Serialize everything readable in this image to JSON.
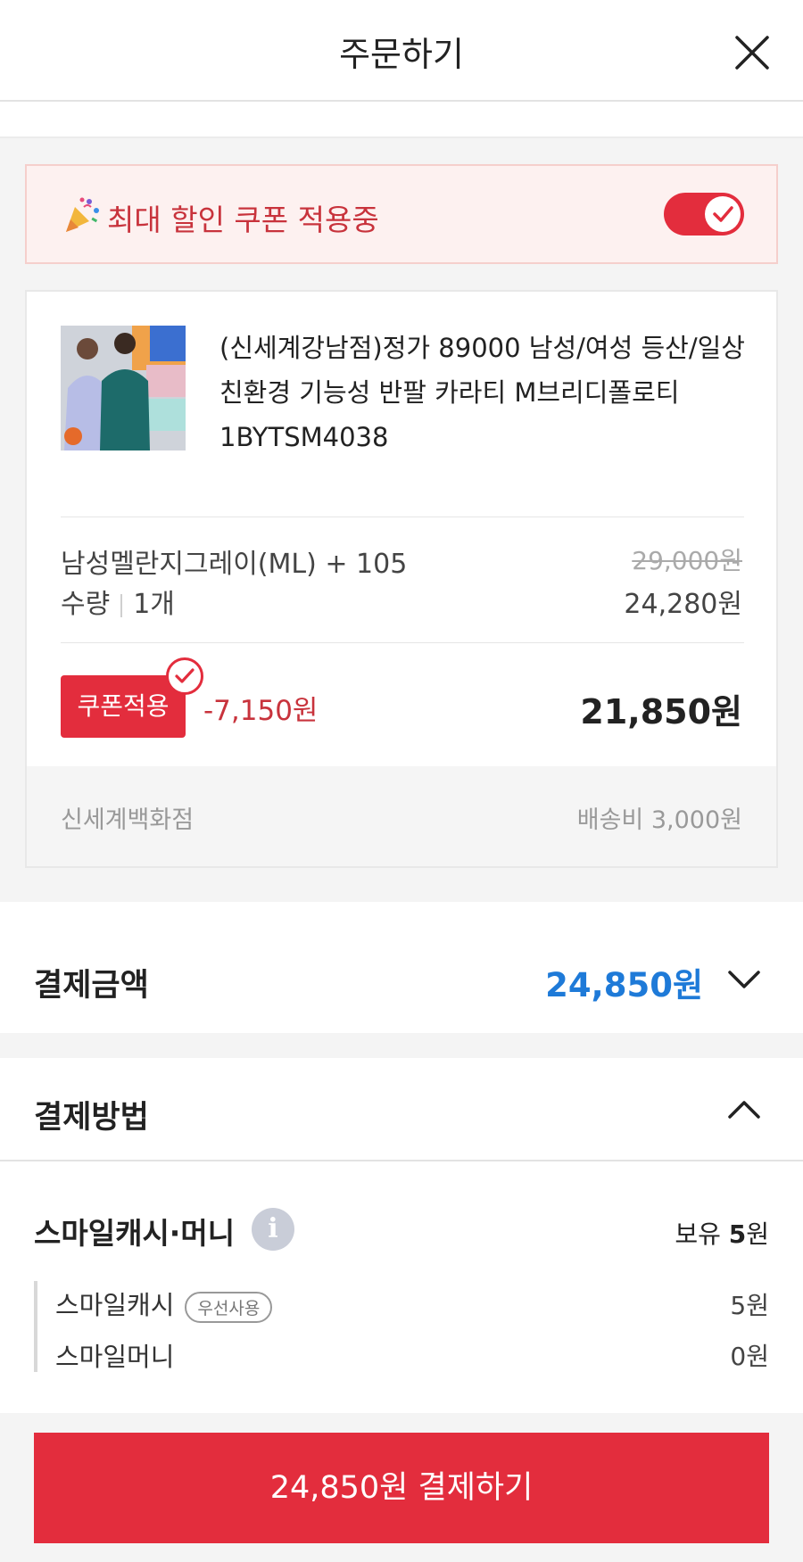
{
  "header": {
    "title": "주문하기",
    "close_icon": "close-icon"
  },
  "coupon_banner": {
    "text": "최대 할인 쿠폰 적용중",
    "icon": "party-popper-icon",
    "toggle_on": true
  },
  "product": {
    "name": "(신세계강남점)정가 89000 남성/여성 등산/일상 친환경 기능성 반팔 카라티 M브리디폴로티 1BYTSM4038",
    "option": "남성멜란지그레이(ML) + 105",
    "qty_label": "수량",
    "qty_value": "1개",
    "original_price": "29,000원",
    "sale_price": "24,280원",
    "coupon_button": "쿠폰적용",
    "discount": "-7,150원",
    "final_price": "21,850원",
    "seller": "신세계백화점",
    "shipping": "배송비 3,000원"
  },
  "payment_amount": {
    "label": "결제금액",
    "value": "24,850원",
    "icon": "chevron-down-icon"
  },
  "payment_method": {
    "label": "결제방법",
    "icon": "chevron-up-icon"
  },
  "smile": {
    "title": "스마일캐시·머니",
    "info_icon": "i",
    "owned_prefix": "보유 ",
    "owned_amount": "5",
    "owned_suffix": "원",
    "items": [
      {
        "label": "스마일캐시",
        "badge": "우선사용",
        "value": "5원"
      },
      {
        "label": "스마일머니",
        "value": "0원"
      }
    ]
  },
  "checkout": {
    "label": "24,850원 결제하기"
  },
  "colors": {
    "brand_red": "#e32d3d",
    "accent_blue": "#1e7ad8",
    "banner_bg": "#fdf1f0"
  }
}
